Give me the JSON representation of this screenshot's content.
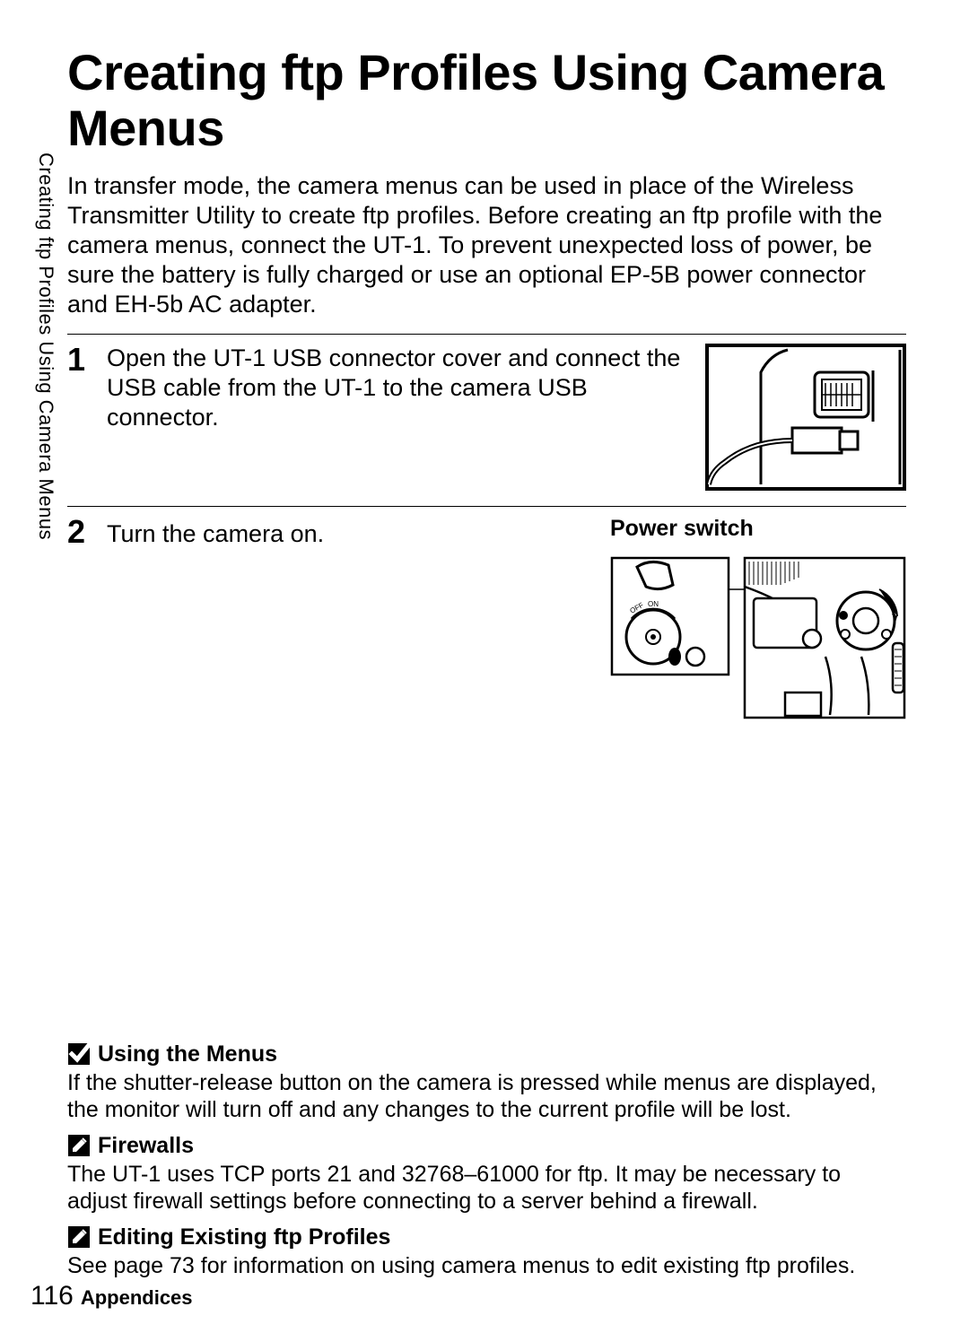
{
  "vertical_label": "Creating ftp Profiles Using Camera Menus",
  "title": "Creating ftp Profiles Using Camera Menus",
  "intro": "In transfer mode, the camera menus can be used in place of the Wireless Transmitter Utility to create ftp profiles. Before creating an ftp profile with the camera menus, connect the UT-1. To prevent unexpected loss of power, be sure the battery is fully charged or use an optional EP-5B power connector and EH-5b AC adapter.",
  "steps": [
    {
      "num": "1",
      "text": "Open the UT-1 USB connector cover and connect the USB cable from the UT-1 to the camera USB connector."
    },
    {
      "num": "2",
      "text": "Turn the camera on.",
      "figure_label": "Power switch"
    }
  ],
  "notes": [
    {
      "icon": "check",
      "title": "Using the Menus",
      "body": "If the shutter-release button on the camera is pressed while menus are displayed, the monitor will turn off and any changes to the current profile will be lost."
    },
    {
      "icon": "pencil",
      "title": "Firewalls",
      "body": "The UT-1 uses TCP ports 21 and 32768–61000 for ftp.  It may be necessary to adjust firewall settings before connecting to a server behind a firewall."
    },
    {
      "icon": "pencil",
      "title": "Editing Existing ftp Profiles",
      "body": "See page 73 for information on using camera menus to edit existing ftp profiles."
    }
  ],
  "footer": {
    "page_number": "116",
    "section": "Appendices"
  }
}
